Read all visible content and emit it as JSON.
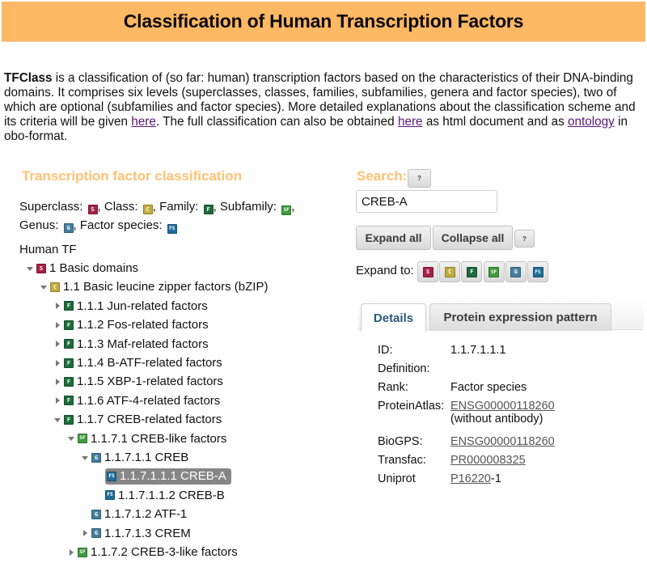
{
  "header": {
    "title": "Classification of Human Transcription Factors"
  },
  "intro": {
    "brand": "TFClass",
    "text1": " is a classification of (so far: human) transcription factors based on the characteristics of their DNA-binding domains. It comprises six levels (superclasses, classes, families, subfamilies, genera and factor species), two of which are optional (subfamilies and factor species). More detailed explanations about the classification scheme and its criteria will be given ",
    "link1": "here",
    "text2": ". The full classification can also be obtained ",
    "link2": "here",
    "text3": " as html document and as ",
    "link3": "ontology",
    "text4": " in obo-format.",
    "link_color": "#5a1a7a"
  },
  "classification": {
    "title": "Transcription factor classification",
    "legend": {
      "superclass": "Superclass:",
      "class": ", Class:",
      "family": ", Family:",
      "subfamily": ", Subfamily:",
      "trail": ",",
      "genus": "Genus:",
      "factor_species": ", Factor species:"
    },
    "root": "Human TF",
    "level_icons": {
      "s": {
        "glyph": "S",
        "name": "superclass-icon",
        "color": "#a3234a"
      },
      "c": {
        "glyph": "C",
        "name": "class-icon",
        "color": "#c2ad3e"
      },
      "f": {
        "glyph": "F",
        "name": "family-icon",
        "color": "#1c6b3a"
      },
      "sf": {
        "glyph": "SF",
        "name": "subfamily-icon",
        "color": "#3f9a3c"
      },
      "g": {
        "glyph": "G",
        "name": "genus-icon",
        "color": "#437f9c"
      },
      "fs": {
        "glyph": "FS",
        "name": "factor-species-icon",
        "color": "#1f6d99"
      }
    },
    "tree": [
      {
        "label": "1 Basic domains",
        "level": "s",
        "depth": 0,
        "toggle": "open"
      },
      {
        "label": "1.1 Basic leucine zipper factors (bZIP)",
        "level": "c",
        "depth": 1,
        "toggle": "open"
      },
      {
        "label": "1.1.1 Jun-related factors",
        "level": "f",
        "depth": 2,
        "toggle": "closed"
      },
      {
        "label": "1.1.2 Fos-related factors",
        "level": "f",
        "depth": 2,
        "toggle": "closed"
      },
      {
        "label": "1.1.3 Maf-related factors",
        "level": "f",
        "depth": 2,
        "toggle": "closed"
      },
      {
        "label": "1.1.4 B-ATF-related factors",
        "level": "f",
        "depth": 2,
        "toggle": "closed"
      },
      {
        "label": "1.1.5 XBP-1-related factors",
        "level": "f",
        "depth": 2,
        "toggle": "closed"
      },
      {
        "label": "1.1.6 ATF-4-related factors",
        "level": "f",
        "depth": 2,
        "toggle": "closed"
      },
      {
        "label": "1.1.7 CREB-related factors",
        "level": "f",
        "depth": 2,
        "toggle": "open"
      },
      {
        "label": "1.1.7.1 CREB-like factors",
        "level": "sf",
        "depth": 3,
        "toggle": "open"
      },
      {
        "label": "1.1.7.1.1 CREB",
        "level": "g",
        "depth": 4,
        "toggle": "open"
      },
      {
        "label": "1.1.7.1.1.1 CREB-A",
        "level": "fs",
        "depth": 5,
        "toggle": "none",
        "selected": true
      },
      {
        "label": "1.1.7.1.1.2 CREB-B",
        "level": "fs",
        "depth": 5,
        "toggle": "none"
      },
      {
        "label": "1.1.7.1.2 ATF-1",
        "level": "g",
        "depth": 4,
        "toggle": "none"
      },
      {
        "label": "1.1.7.1.3 CREM",
        "level": "g",
        "depth": 4,
        "toggle": "closed"
      },
      {
        "label": "1.1.7.2 CREB-3-like factors",
        "level": "sf",
        "depth": 3,
        "toggle": "closed"
      }
    ]
  },
  "search": {
    "title": "Search:",
    "help": "?",
    "value": "CREB-A",
    "expand_all": "Expand all",
    "collapse_all": "Collapse all",
    "expand_help": "?",
    "expand_to": "Expand to:"
  },
  "tabs": [
    {
      "label": "Details",
      "active": true
    },
    {
      "label": "Protein expression pattern",
      "active": false
    }
  ],
  "details": {
    "id_label": "ID:",
    "id_value": "1.1.7.1.1.1",
    "definition_label": "Definition:",
    "definition_value": "",
    "rank_label": "Rank:",
    "rank_value": "Factor species",
    "proteinatlas_label": "ProteinAtlas:",
    "proteinatlas_link": "ENSG00000118260",
    "proteinatlas_note": "(without antibody)",
    "biogps_label": "BioGPS:",
    "biogps_link": "ENSG00000118260",
    "transfac_label": "Transfac:",
    "transfac_link": "PR000008325",
    "uniprot_label": "Uniprot",
    "uniprot_link": "P16220",
    "uniprot_suffix": "-1"
  },
  "colors": {
    "header_bg": "#ffb864",
    "section_title": "#ffc173",
    "selected_bg": "#868686",
    "active_tab_text": "#2a5a78"
  }
}
